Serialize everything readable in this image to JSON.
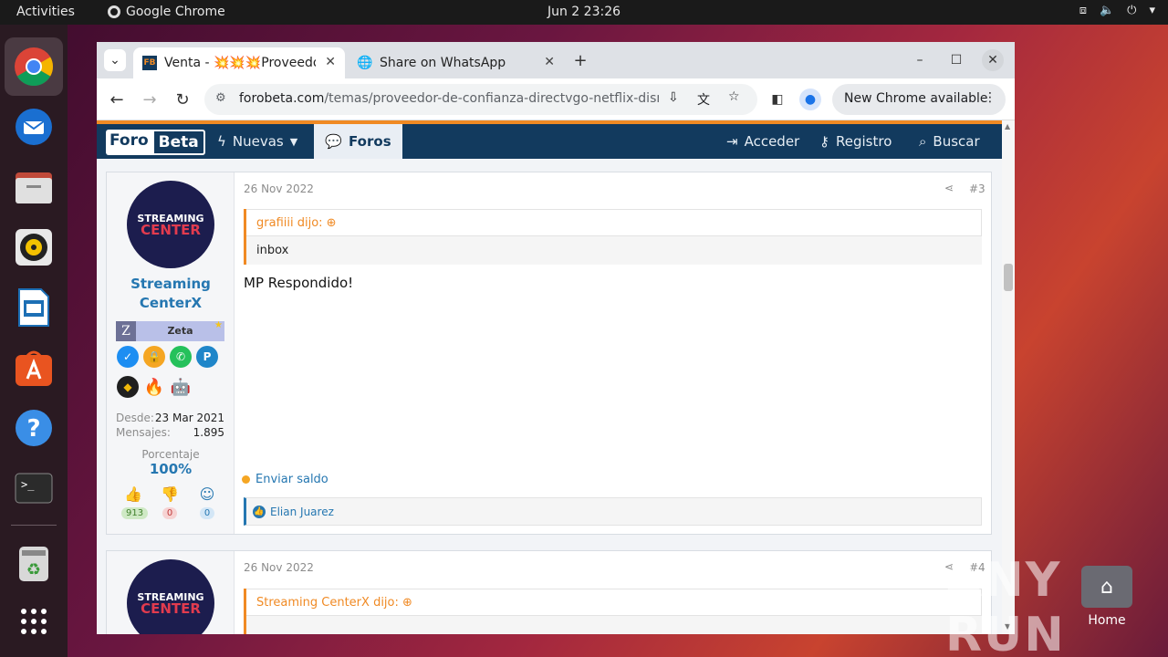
{
  "topbar": {
    "activities": "Activities",
    "app": "Google Chrome",
    "clock": "Jun 2  23:26"
  },
  "browser": {
    "tabs": [
      {
        "title": "Venta - 💥💥💥Proveedor de confianza",
        "favicon": "FB"
      },
      {
        "title": "Share on WhatsApp"
      }
    ],
    "url_host": "forobeta.com",
    "url_path": "/temas/proveedor-de-confianza-directvgo-netflix-disney-…",
    "new_chrome": "New Chrome available"
  },
  "site": {
    "logo_a": "Foro",
    "logo_b": "Beta",
    "nav": {
      "nuevas": "Nuevas",
      "foros": "Foros",
      "acceder": "Acceder",
      "registro": "Registro",
      "buscar": "Buscar"
    }
  },
  "posts": [
    {
      "avatar_top": "STREAMING",
      "avatar_bottom": "CENTER",
      "user_line1": "Streaming",
      "user_line2": "CenterX",
      "rank_letter": "Z",
      "rank": "Zeta",
      "desde_label": "Desde:",
      "desde": "23 Mar 2021",
      "mensajes_label": "Mensajes:",
      "mensajes": "1.895",
      "pct_label": "Porcentaje",
      "pct": "100%",
      "reactions": {
        "up": "913",
        "down": "0",
        "neutral": "0"
      },
      "date": "26 Nov 2022",
      "num": "#3",
      "quote_author": "grafiiii dijo:",
      "quote_body": "inbox",
      "text": "MP Respondido!",
      "send": "Enviar saldo",
      "likes": "Elian Juarez"
    },
    {
      "avatar_top": "STREAMING",
      "avatar_bottom": "CENTER",
      "date": "26 Nov 2022",
      "num": "#4",
      "quote_author": "Streaming CenterX dijo:"
    }
  ],
  "watermark": "ANY RUN",
  "desktop": {
    "home": "Home"
  }
}
